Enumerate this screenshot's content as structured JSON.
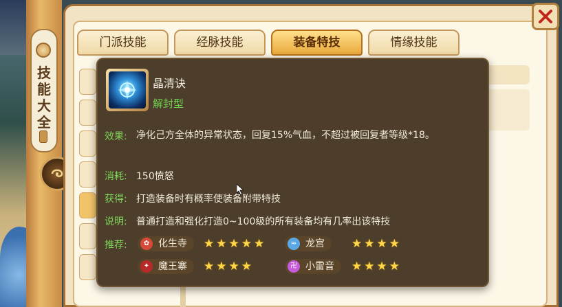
{
  "sidebar": {
    "title": "技能大全"
  },
  "tabs": [
    {
      "label": "门派技能",
      "active": false
    },
    {
      "label": "经脉技能",
      "active": false
    },
    {
      "label": "装备特技",
      "active": true
    },
    {
      "label": "情缘技能",
      "active": false
    }
  ],
  "tooltip": {
    "skill_name": "晶清诀",
    "skill_type": "解封型",
    "effect_label": "效果:",
    "effect_text": "净化己方全体的异常状态，回复15%气血，不超过被回复者等级*18。",
    "cost_label": "消耗:",
    "cost_text": "150愤怒",
    "obtain_label": "获得:",
    "obtain_text": "打造装备时有概率使装备附带特技",
    "note_label": "说明:",
    "note_text": "普通打造和强化打造0~100级的所有装备均有几率出该特技",
    "recommend_label": "推荐:",
    "recommendations": [
      {
        "sect": "化生寺",
        "stars": 5,
        "icon": "huashengsi-icon",
        "color": "#d64a3a"
      },
      {
        "sect": "龙宫",
        "stars": 4,
        "icon": "longgong-icon",
        "color": "#5aa9e6"
      },
      {
        "sect": "魔王寨",
        "stars": 4,
        "icon": "mowangzhai-icon",
        "color": "#b82a2a"
      },
      {
        "sect": "小雷音",
        "stars": 4,
        "icon": "xiaoleiyin-icon",
        "color": "#c65ad8"
      }
    ]
  },
  "icons": {
    "close": "close-icon",
    "collapse": "collapse-icon",
    "skill": "crystal-skill-icon",
    "star": "star-icon"
  }
}
